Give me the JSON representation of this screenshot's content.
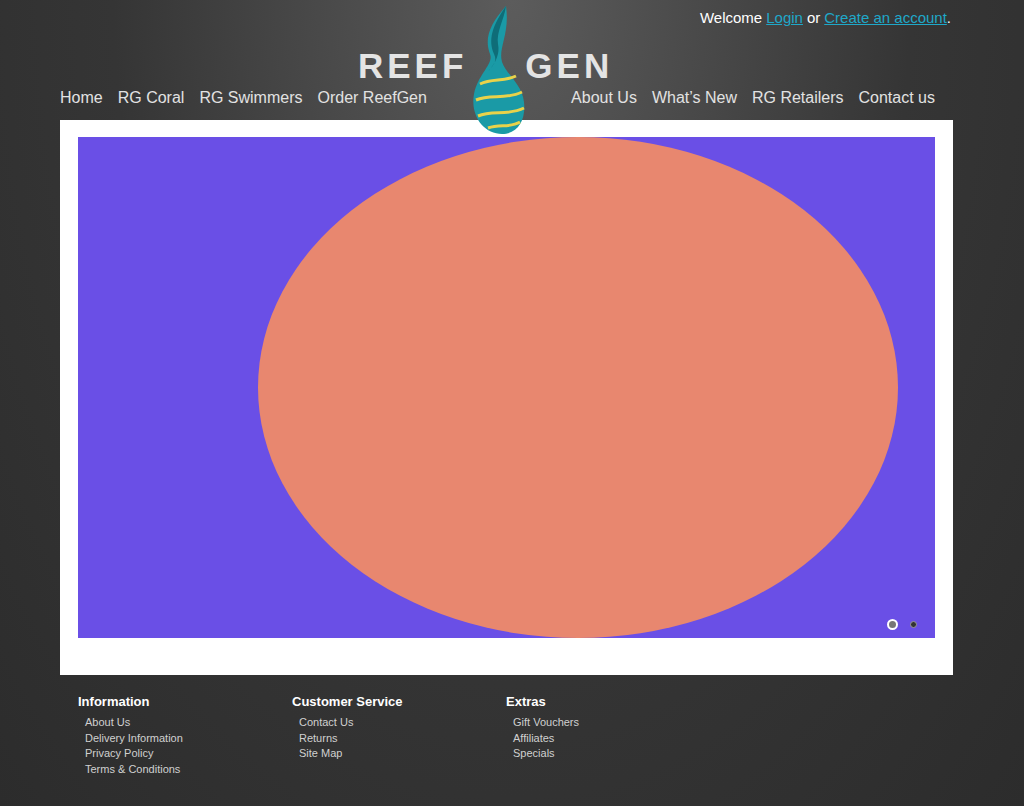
{
  "header": {
    "welcome": "Welcome",
    "login": "Login",
    "or": "or",
    "create_account": "Create an account",
    "period": "."
  },
  "logo": {
    "left": "REEF",
    "right": "GEN"
  },
  "nav": {
    "left": [
      "Home",
      "RG Coral",
      "RG Swimmers",
      "Order ReefGen"
    ],
    "right": [
      "About Us",
      "What’s New",
      "RG Retailers",
      "Contact us"
    ]
  },
  "slider": {
    "dots": [
      {
        "selected": true
      },
      {
        "selected": false
      }
    ]
  },
  "footer": {
    "columns": [
      {
        "title": "Information",
        "links": [
          "About Us",
          "Delivery Information",
          "Privacy Policy",
          "Terms & Conditions"
        ]
      },
      {
        "title": "Customer Service",
        "links": [
          "Contact Us",
          "Returns",
          "Site Map"
        ]
      },
      {
        "title": "Extras",
        "links": [
          "Gift Vouchers",
          "Affiliates",
          "Specials"
        ]
      }
    ]
  }
}
